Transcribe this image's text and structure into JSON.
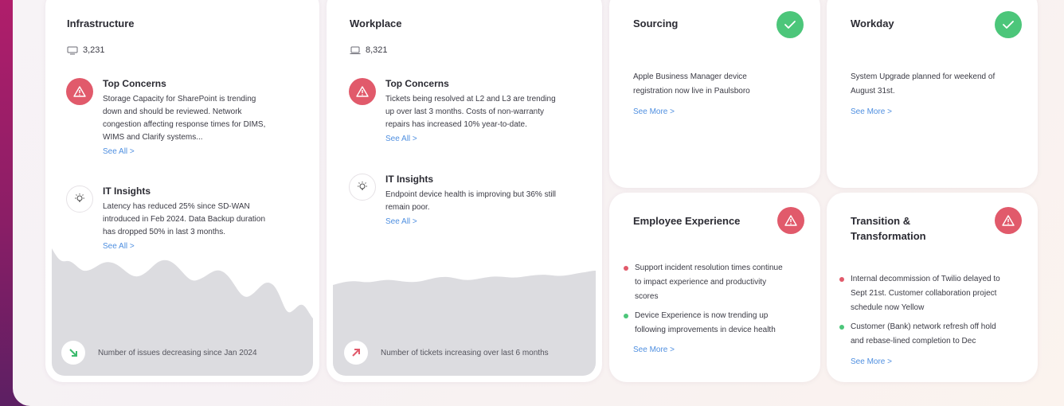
{
  "colors": {
    "red": "#e15a6b",
    "green": "#4cc67a",
    "blue": "#4f8fe0"
  },
  "infrastructure": {
    "title": "Infrastructure",
    "count": "3,231",
    "concerns": {
      "title": "Top Concerns",
      "lines": [
        "Storage Capacity for SharePoint is trending",
        "down and should be reviewed. Network",
        "congestion affecting response times for DIMS,",
        "WIMS and Clarify systems..."
      ],
      "see_all": "See All >"
    },
    "insights": {
      "title": "IT Insights",
      "lines": [
        "Latency has reduced 25% since SD-WAN",
        "introduced in Feb 2024. Data Backup duration",
        "has dropped 50% in last 3 months."
      ],
      "see_all": "See All >"
    },
    "trend_text": "Number of issues decreasing since Jan 2024"
  },
  "workplace": {
    "title": "Workplace",
    "count": "8,321",
    "concerns": {
      "title": "Top Concerns",
      "lines": [
        "Tickets being resolved at L2 and L3 are trending",
        "up over last 3 months. Costs of non-warranty",
        "repairs has increased 10% year-to-date."
      ],
      "see_all": "See All >"
    },
    "insights": {
      "title": "IT Insights",
      "lines": [
        "Endpoint device health is improving but 36% still",
        "remain poor."
      ],
      "see_all": "See All >"
    },
    "trend_text": "Number of tickets increasing over last 6 months"
  },
  "sourcing": {
    "title": "Sourcing",
    "lines": [
      "Apple Business Manager device",
      "registration now live in Paulsboro"
    ],
    "see_more": "See More >"
  },
  "workday": {
    "title": "Workday",
    "lines": [
      "System Upgrade planned for weekend of",
      "August 31st."
    ],
    "see_more": "See More >"
  },
  "employee_experience": {
    "title": "Employee Experience",
    "bullets": [
      {
        "lines": [
          "Support incident resolution times continue",
          "to impact experience and productivity",
          "scores"
        ]
      },
      {
        "lines": [
          "Device Experience is now trending up",
          "following improvements in device health"
        ]
      }
    ],
    "see_more": "See More >"
  },
  "transition": {
    "title_lines": [
      "Transition &",
      "Transformation"
    ],
    "bullets": [
      {
        "lines": [
          "Internal decommission of Twilio delayed to",
          "Sept 21st. Customer collaboration project",
          "schedule now Yellow"
        ]
      },
      {
        "lines": [
          "Customer (Bank) network refresh off hold",
          "and rebase-lined completion to Dec"
        ]
      }
    ],
    "see_more": "See More >"
  }
}
